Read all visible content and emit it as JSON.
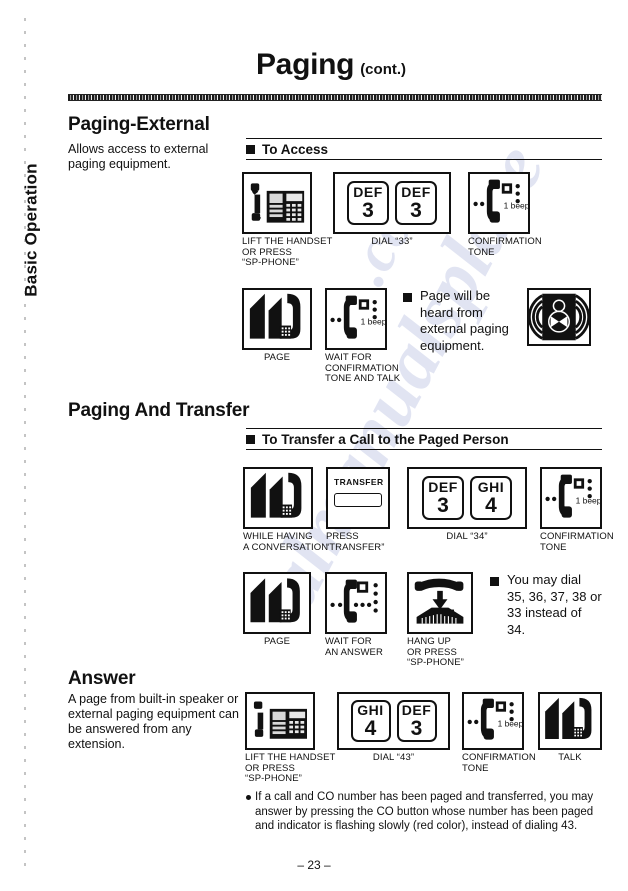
{
  "document": {
    "side_tab": "Basic Operation",
    "title": "Paging",
    "title_suffix": "(cont.)",
    "page_number": "– 23 –"
  },
  "sections": [
    {
      "heading": "Paging-External",
      "lead": "Allows access to external paging equipment.",
      "subhead": "To Access",
      "steps_row1": [
        {
          "icon": "desk-phone-handset-lifted-icon",
          "caption": "LIFT THE HANDSET\nOR PRESS\n“SP-PHONE”"
        },
        {
          "icon": "dial-keys-icon",
          "caption": "DIAL “33”",
          "keys": [
            {
              "alpha": "DEF",
              "num": "3"
            },
            {
              "alpha": "DEF",
              "num": "3"
            }
          ]
        },
        {
          "icon": "handset-beep-icon",
          "caption": "CONFIRMATION\nTONE",
          "beep": "1 beep"
        }
      ],
      "steps_row2": [
        {
          "icon": "page-handset-icon",
          "caption": "PAGE"
        },
        {
          "icon": "handset-beep-icon",
          "caption": "WAIT FOR\nCONFIRMATION\nTONE AND TALK",
          "beep": "1 beep"
        }
      ],
      "note": "Page will be heard from external paging equipment.",
      "note_icon": "external-speaker-icon"
    },
    {
      "heading": "Paging And Transfer",
      "subhead": "To Transfer a Call to the Paged Person",
      "steps_row1": [
        {
          "icon": "conversation-handset-icon",
          "caption": "WHILE HAVING\nA CONVERSATION"
        },
        {
          "icon": "transfer-button-icon",
          "caption": "PRESS\n“TRANSFER”",
          "button_label": "TRANSFER"
        },
        {
          "icon": "dial-keys-icon",
          "caption": "DIAL “34”",
          "keys": [
            {
              "alpha": "DEF",
              "num": "3"
            },
            {
              "alpha": "GHI",
              "num": "4"
            }
          ]
        },
        {
          "icon": "handset-beep-icon",
          "caption": "CONFIRMATION\nTONE",
          "beep": "1 beep"
        }
      ],
      "steps_row2": [
        {
          "icon": "page-handset-icon",
          "caption": "PAGE"
        },
        {
          "icon": "handset-wait-icon",
          "caption": "WAIT FOR\nAN ANSWER"
        },
        {
          "icon": "hang-up-icon",
          "caption": "HANG UP\nOR PRESS\n“SP-PHONE”"
        }
      ],
      "note": "You may dial 35, 36, 37, 38 or 33 instead of 34."
    },
    {
      "heading": "Answer",
      "lead": "A page from built-in speaker or external paging equipment can be answered from any extension.",
      "steps_row1": [
        {
          "icon": "desk-phone-handset-lifted-icon",
          "caption": "LIFT THE HANDSET\nOR PRESS\n“SP-PHONE”"
        },
        {
          "icon": "dial-keys-icon",
          "caption": "DIAL “43”",
          "keys": [
            {
              "alpha": "GHI",
              "num": "4"
            },
            {
              "alpha": "DEF",
              "num": "3"
            }
          ]
        },
        {
          "icon": "handset-beep-icon",
          "caption": "CONFIRMATION\nTONE",
          "beep": "1 beep"
        },
        {
          "icon": "talk-handset-icon",
          "caption": "TALK"
        }
      ],
      "footnote": "If a call and CO number has been paged and transferred, you may answer by pressing the CO button whose number has been paged and indicator is flashing slowly (red color), instead of dialing 43."
    }
  ],
  "watermark": {
    "text1": "almanualsplace",
    "text2": ".com"
  },
  "colors": {
    "ink": "#111111",
    "paper": "#ffffff",
    "watermark": "#c9cfe8"
  }
}
